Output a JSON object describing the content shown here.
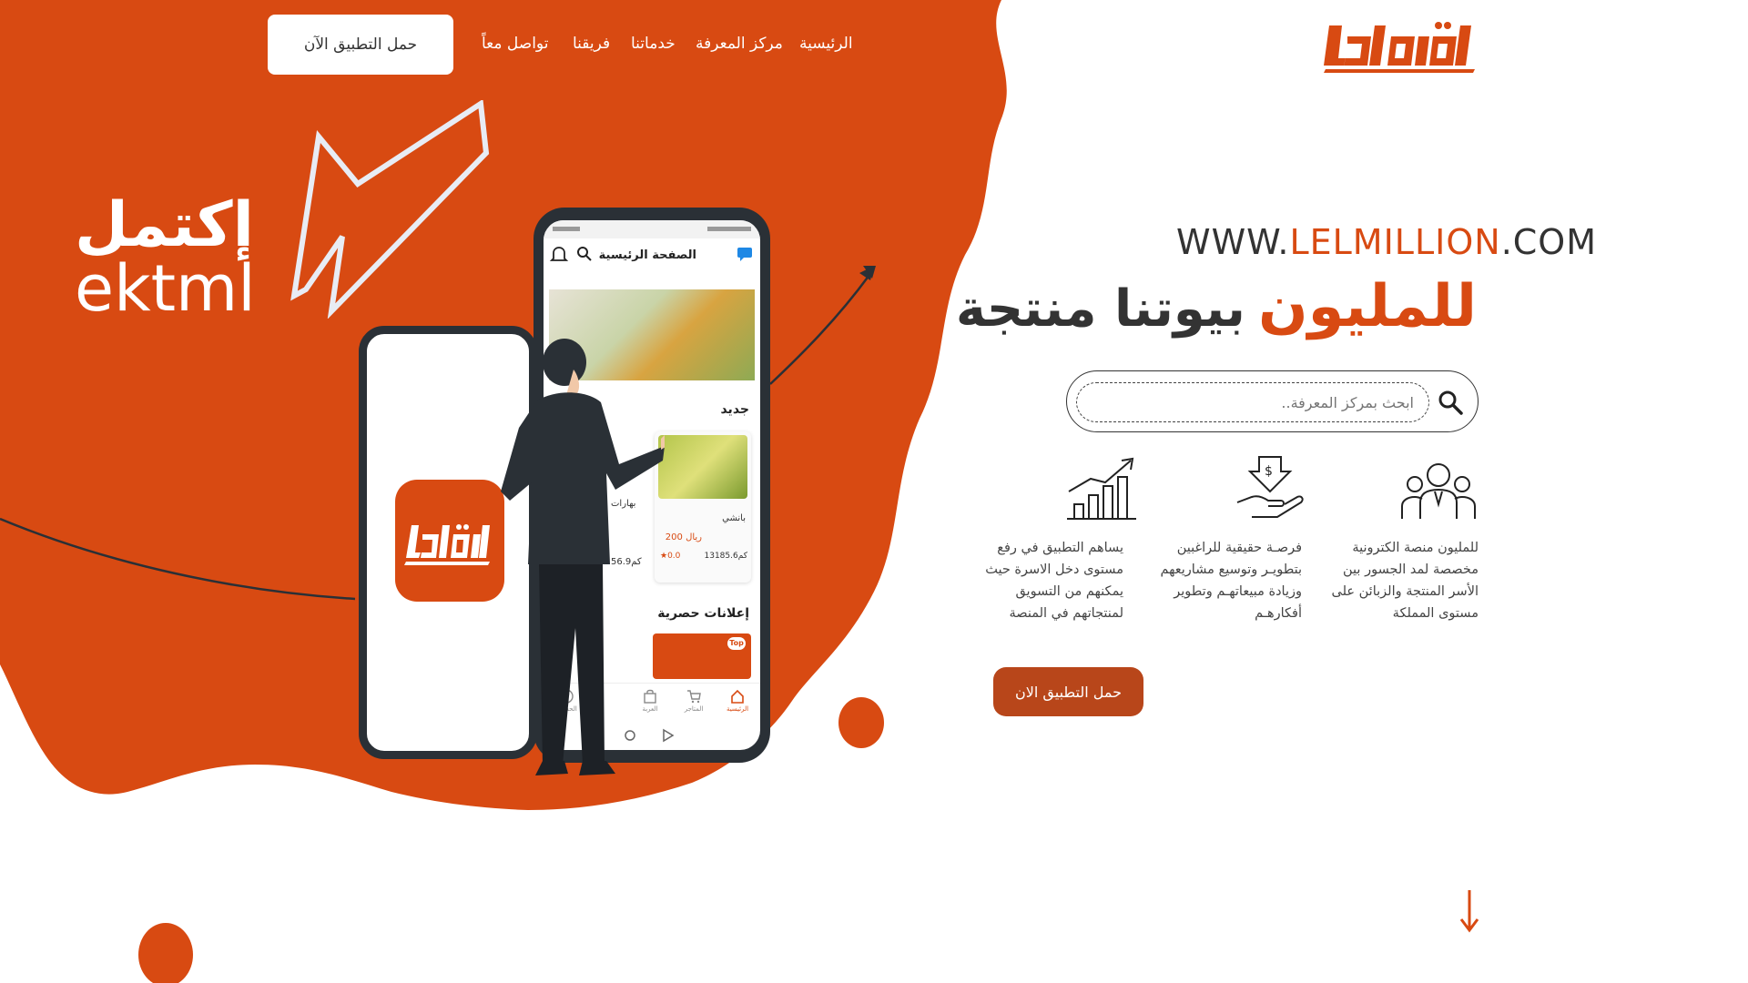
{
  "nav": {
    "items": [
      "الرئيسية",
      "مركز المعرفة",
      "خدماتنا",
      "فريقنا",
      "تواصل معاً"
    ],
    "download_label": "حمل التطبيق الآن"
  },
  "brand": {
    "logo_text": "للمليون",
    "ar_name": "إكتمل",
    "en_name": "ektml"
  },
  "hero": {
    "url_prefix": "WWW.",
    "url_accent": "LELMILLION",
    "url_suffix": ".COM",
    "headline_accent": "للمليون",
    "headline_rest": "بيوتنا منتجة"
  },
  "search": {
    "placeholder": "ابحث بمركز المعرفة.."
  },
  "features": [
    {
      "icon": "people-group-icon",
      "text": "للمليون منصة الكترونية مخصصة لمد الجسور بين الأسر المنتجة والزبائن على مستوى المملكة"
    },
    {
      "icon": "hand-money-icon",
      "text": "فرصـة حقيقية للراغبين بتطويـر وتوسيع مشاريعهم وزيادة مبيعاتهـم وتطوير أفكارهـم"
    },
    {
      "icon": "growth-chart-icon",
      "text": "يساهم التطبيق في رفع مستوى دخل الاسرة حيث يمكنهم من التسويق لمنتجاتهم في المنصة"
    }
  ],
  "cta": {
    "download_label": "حمل التطبيق الان"
  },
  "phone": {
    "screen_title": "الصفحة الرئيسية",
    "section_new": "جديد",
    "card_name": "بانشي",
    "card_price": "200 ريال",
    "card_rating": "0.0",
    "card_distance": "13185.6كم",
    "card2_title": "بهارات",
    "card2_distance": "56.9كم",
    "section_ads": "إعلانات حصرية",
    "ad_badge": "Top",
    "tabs": [
      "الرئيسية",
      "المتاجر",
      "العربة",
      "",
      "الحساب"
    ]
  },
  "colors": {
    "brand_orange": "#d84a12",
    "dark": "#2a3036",
    "cta_brown": "#b8461a"
  }
}
